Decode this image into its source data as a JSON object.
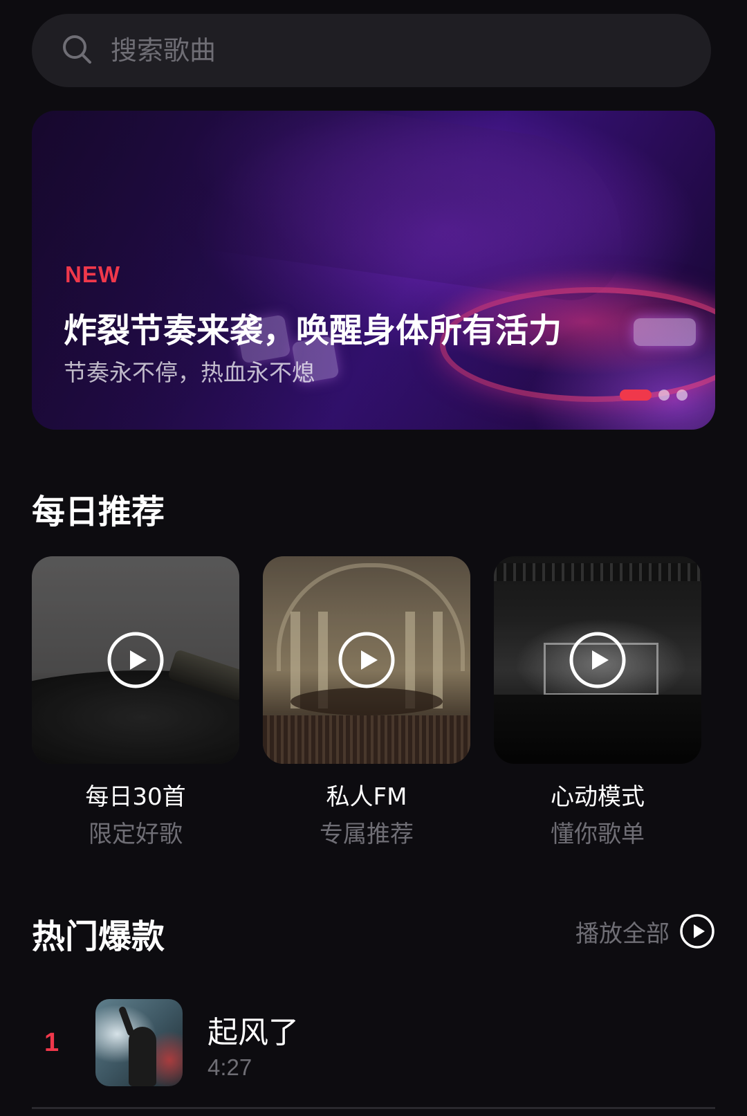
{
  "search": {
    "placeholder": "搜索歌曲",
    "icon": "search-icon"
  },
  "banner": {
    "tag": "NEW",
    "title": "炸裂节奏来袭，唤醒身体所有活力",
    "subtitle": "节奏永不停，热血永不熄",
    "pages": 3,
    "active_page": 1,
    "accent_color": "#f0384b"
  },
  "daily": {
    "title": "每日推荐",
    "cards": [
      {
        "title": "每日30首",
        "subtitle": "限定好歌",
        "icon": "play-circle-icon"
      },
      {
        "title": "私人FM",
        "subtitle": "专属推荐",
        "icon": "play-circle-icon"
      },
      {
        "title": "心动模式",
        "subtitle": "懂你歌单",
        "icon": "play-circle-icon"
      }
    ]
  },
  "hot": {
    "title": "热门爆款",
    "play_all_label": "播放全部",
    "play_all_icon": "play-circle-icon",
    "songs": [
      {
        "rank": "1",
        "title": "起风了",
        "duration": "4:27"
      }
    ]
  },
  "colors": {
    "background": "#0d0c10",
    "accent": "#f0384b",
    "muted_text": "#6f6e75",
    "search_bg": "#1f1e23"
  }
}
